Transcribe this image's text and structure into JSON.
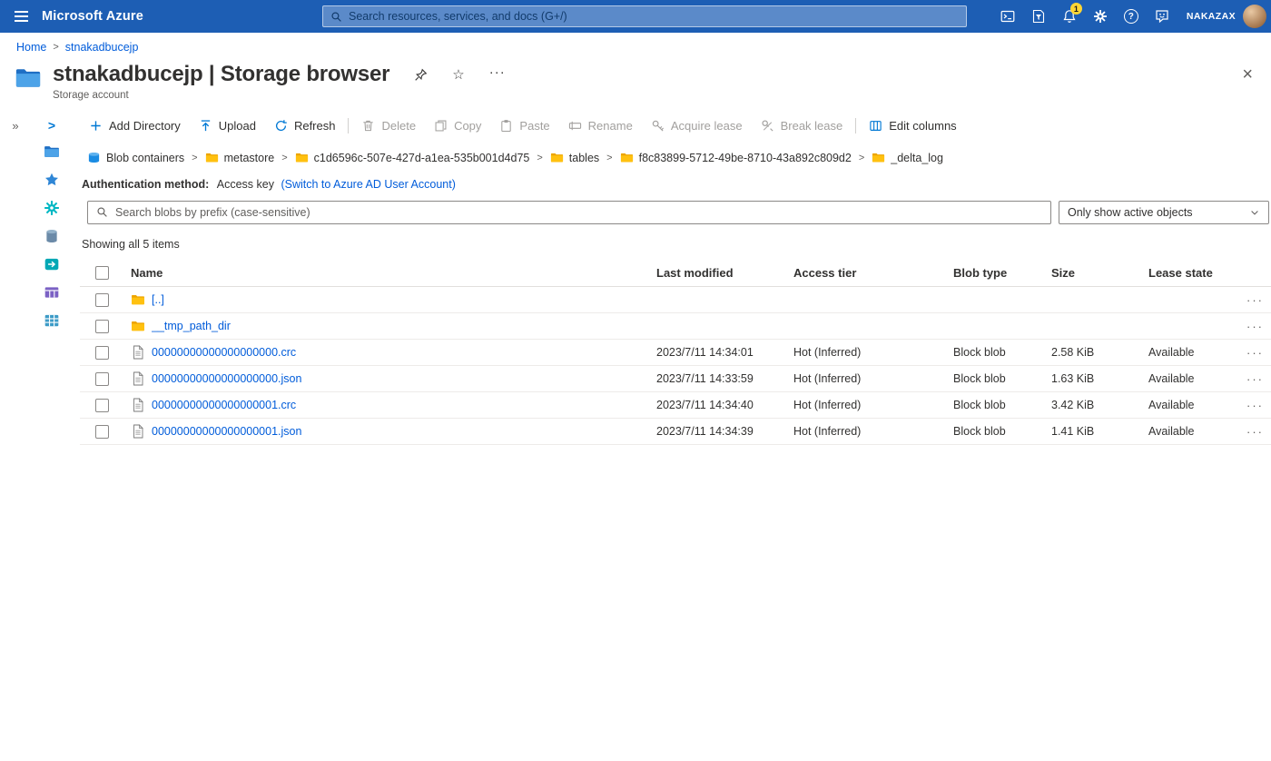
{
  "topbar": {
    "product_name": "Microsoft Azure",
    "search_placeholder": "Search resources, services, and docs (G+/)",
    "notification_badge": "1",
    "user_name": "NAKAZAX"
  },
  "breadcrumb": {
    "home": "Home",
    "current": "stnakadbucejp"
  },
  "page_header": {
    "title": "stnakadbucejp | Storage browser",
    "subtitle": "Storage account"
  },
  "toolbar": {
    "add_directory": "Add Directory",
    "upload": "Upload",
    "refresh": "Refresh",
    "delete": "Delete",
    "copy": "Copy",
    "paste": "Paste",
    "rename": "Rename",
    "acquire_lease": "Acquire lease",
    "break_lease": "Break lease",
    "edit_columns": "Edit columns"
  },
  "path": {
    "segments": [
      "Blob containers",
      "metastore",
      "c1d6596c-507e-427d-a1ea-535b001d4d75",
      "tables",
      "f8c83899-5712-49be-8710-43a892c809d2",
      "_delta_log"
    ]
  },
  "auth": {
    "label": "Authentication method:",
    "value": "Access key",
    "switch_link": "(Switch to Azure AD User Account)"
  },
  "filter": {
    "search_placeholder": "Search blobs by prefix (case-sensitive)",
    "view_filter": "Only show active objects"
  },
  "summary": "Showing all 5 items",
  "table": {
    "headers": {
      "name": "Name",
      "last_modified": "Last modified",
      "access_tier": "Access tier",
      "blob_type": "Blob type",
      "size": "Size",
      "lease_state": "Lease state"
    },
    "rows": [
      {
        "name": "[..]",
        "kind": "folder",
        "last_modified": "",
        "access_tier": "",
        "blob_type": "",
        "size": "",
        "lease_state": ""
      },
      {
        "name": "__tmp_path_dir",
        "kind": "folder",
        "last_modified": "",
        "access_tier": "",
        "blob_type": "",
        "size": "",
        "lease_state": ""
      },
      {
        "name": "00000000000000000000.crc",
        "kind": "file",
        "last_modified": "2023/7/11 14:34:01",
        "access_tier": "Hot (Inferred)",
        "blob_type": "Block blob",
        "size": "2.58 KiB",
        "lease_state": "Available"
      },
      {
        "name": "00000000000000000000.json",
        "kind": "file",
        "last_modified": "2023/7/11 14:33:59",
        "access_tier": "Hot (Inferred)",
        "blob_type": "Block blob",
        "size": "1.63 KiB",
        "lease_state": "Available"
      },
      {
        "name": "00000000000000000001.crc",
        "kind": "file",
        "last_modified": "2023/7/11 14:34:40",
        "access_tier": "Hot (Inferred)",
        "blob_type": "Block blob",
        "size": "3.42 KiB",
        "lease_state": "Available"
      },
      {
        "name": "00000000000000000001.json",
        "kind": "file",
        "last_modified": "2023/7/11 14:34:39",
        "access_tier": "Hot (Inferred)",
        "blob_type": "Block blob",
        "size": "1.41 KiB",
        "lease_state": "Available"
      }
    ]
  },
  "icons": {
    "more": "···",
    "double_chevron": "»",
    "tree_chevron": ">",
    "separator": ">",
    "close": "×",
    "star": "☆",
    "question": "?"
  },
  "colors": {
    "topbar": "#1d5eb4",
    "accent": "#0078d4",
    "link": "#015cda",
    "folder_yellow": "#ffb900",
    "disabled_gray": "#a19f9d"
  }
}
